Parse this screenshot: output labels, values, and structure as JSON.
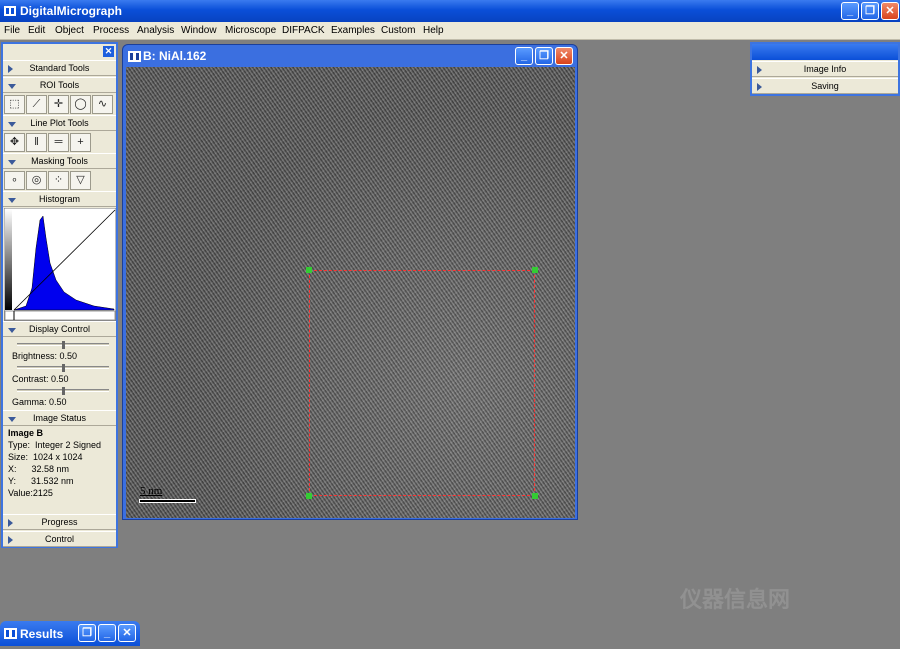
{
  "app": {
    "title": "DigitalMicrograph",
    "window_buttons": {
      "minimize": "_",
      "restore": "❐",
      "close": "✕"
    }
  },
  "menu": [
    "File",
    "Edit",
    "Object",
    "Process",
    "Analysis",
    "Window",
    "Microscope",
    "DIFPACK",
    "Examples",
    "Custom",
    "Help"
  ],
  "tools": {
    "close": "✕",
    "standard_tools": "Standard Tools",
    "roi_tools": "ROI Tools",
    "roi_buttons": [
      "⬚",
      "⟋",
      "✛",
      "◯",
      "∿"
    ],
    "line_plot_tools": "Line Plot Tools",
    "line_buttons": [
      "✥",
      "‖",
      "═",
      "+"
    ],
    "masking_tools": "Masking Tools",
    "mask_buttons": [
      "∘",
      "◎",
      "⁘",
      "▽"
    ],
    "histogram": "Histogram",
    "display_control": "Display Control",
    "brightness": "Brightness: 0.50",
    "contrast": "Contrast: 0.50",
    "gamma": "Gamma: 0.50",
    "brightness_value": 0.5,
    "contrast_value": 0.5,
    "gamma_value": 0.5,
    "image_status": "Image Status",
    "status": {
      "name": "Image B",
      "type": "Type:  Integer 2 Signed",
      "size": "Size:  1024 x 1024",
      "x": "X:      32.58 nm",
      "y": "Y:      31.532 nm",
      "value": "Value:2125"
    },
    "progress": "Progress",
    "control": "Control"
  },
  "image_window": {
    "title": "B: NiAl.162",
    "scale_label": "5 nm"
  },
  "info_panel": {
    "image_info": "Image Info",
    "saving": "Saving"
  },
  "results": {
    "title": "Results"
  },
  "watermark": "仪器信息网",
  "colors": {
    "titlebar": "#0a4fd8",
    "panel": "#ece9d8",
    "workspace": "#7f7f7f",
    "roi": "#ff3333",
    "roi_handle": "#33cc33",
    "histogram_fill": "#0000ee"
  }
}
